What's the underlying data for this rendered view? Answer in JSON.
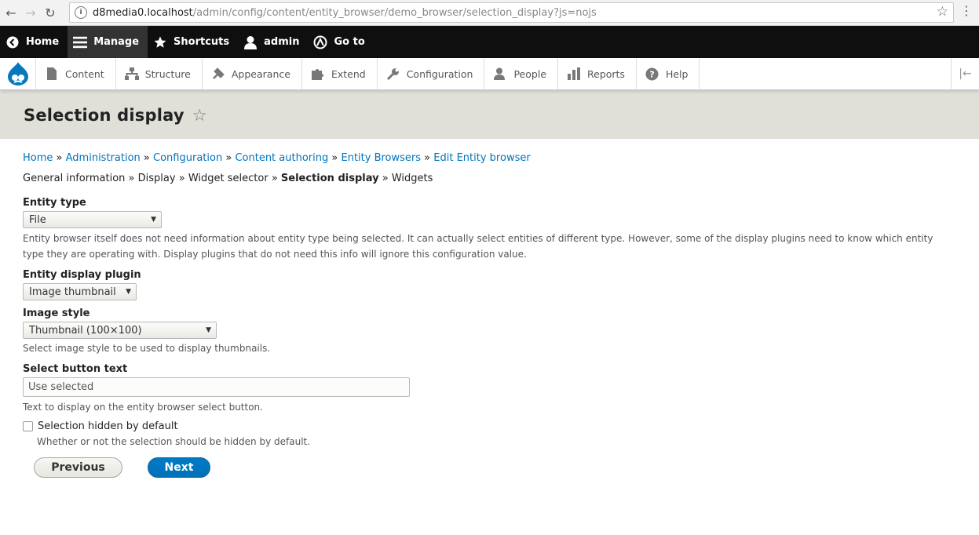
{
  "browser": {
    "url_host": "d8media0.localhost",
    "url_path": "/admin/config/content/entity_browser/demo_browser/selection_display?js=nojs"
  },
  "toolbar": {
    "home": "Home",
    "manage": "Manage",
    "shortcuts": "Shortcuts",
    "user": "admin",
    "goto": "Go to"
  },
  "tray": {
    "items": [
      {
        "label": "Content",
        "icon": "content-icon"
      },
      {
        "label": "Structure",
        "icon": "structure-icon"
      },
      {
        "label": "Appearance",
        "icon": "appearance-icon"
      },
      {
        "label": "Extend",
        "icon": "extend-icon"
      },
      {
        "label": "Configuration",
        "icon": "configuration-icon"
      },
      {
        "label": "People",
        "icon": "people-icon"
      },
      {
        "label": "Reports",
        "icon": "reports-icon"
      },
      {
        "label": "Help",
        "icon": "help-icon"
      }
    ]
  },
  "page": {
    "title": "Selection display"
  },
  "breadcrumb": [
    "Home",
    "Administration",
    "Configuration",
    "Content authoring",
    "Entity Browsers",
    "Edit Entity browser"
  ],
  "breadcrumb_separator": "»",
  "steps": {
    "items": [
      "General information",
      "Display",
      "Widget selector",
      "Selection display",
      "Widgets"
    ],
    "current": "Selection display"
  },
  "form": {
    "entity_type": {
      "label": "Entity type",
      "value": "File",
      "description": "Entity browser itself does not need information about entity type being selected. It can actually select entities of different type. However, some of the display plugins need to know which entity type they are operating with. Display plugins that do not need this info will ignore this configuration value."
    },
    "display_plugin": {
      "label": "Entity display plugin",
      "value": "Image thumbnail"
    },
    "image_style": {
      "label": "Image style",
      "value": "Thumbnail (100×100)",
      "description": "Select image style to be used to display thumbnails."
    },
    "select_button_text": {
      "label": "Select button text",
      "value": "Use selected",
      "description": "Text to display on the entity browser select button."
    },
    "selection_hidden": {
      "label": "Selection hidden by default",
      "checked": false,
      "description": "Whether or not the selection should be hidden by default."
    },
    "previous_button": "Previous",
    "next_button": "Next"
  },
  "colors": {
    "link": "#0074bd",
    "primary_button": "#0074bd",
    "toolbar_bg": "#0f0f0f",
    "header_bg": "#e0e0d8"
  }
}
